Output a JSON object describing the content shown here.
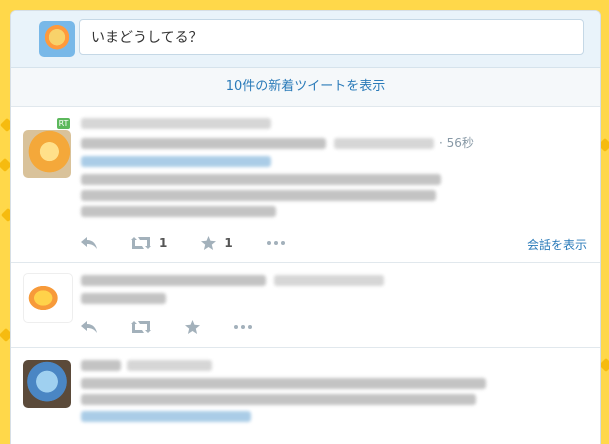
{
  "compose": {
    "placeholder": "いまどうしてる？"
  },
  "new_tweets_bar": {
    "label": "10件の新着ツイートを表示"
  },
  "tweets": [
    {
      "timestamp": "· 56秒",
      "retweet_count": "1",
      "favorite_count": "1",
      "conversation_link": "会話を表示",
      "retweet_badge": "RT"
    },
    {
      "timestamp": "",
      "retweet_count": "",
      "favorite_count": ""
    },
    {
      "timestamp": ""
    }
  ],
  "colors": {
    "background": "#ffd84a",
    "link": "#2b7bb9",
    "compose_bg": "#e9f3fa",
    "icon": "#a3b1bb"
  },
  "icons": [
    "reply-icon",
    "retweet-icon",
    "favorite-icon",
    "more-icon"
  ]
}
